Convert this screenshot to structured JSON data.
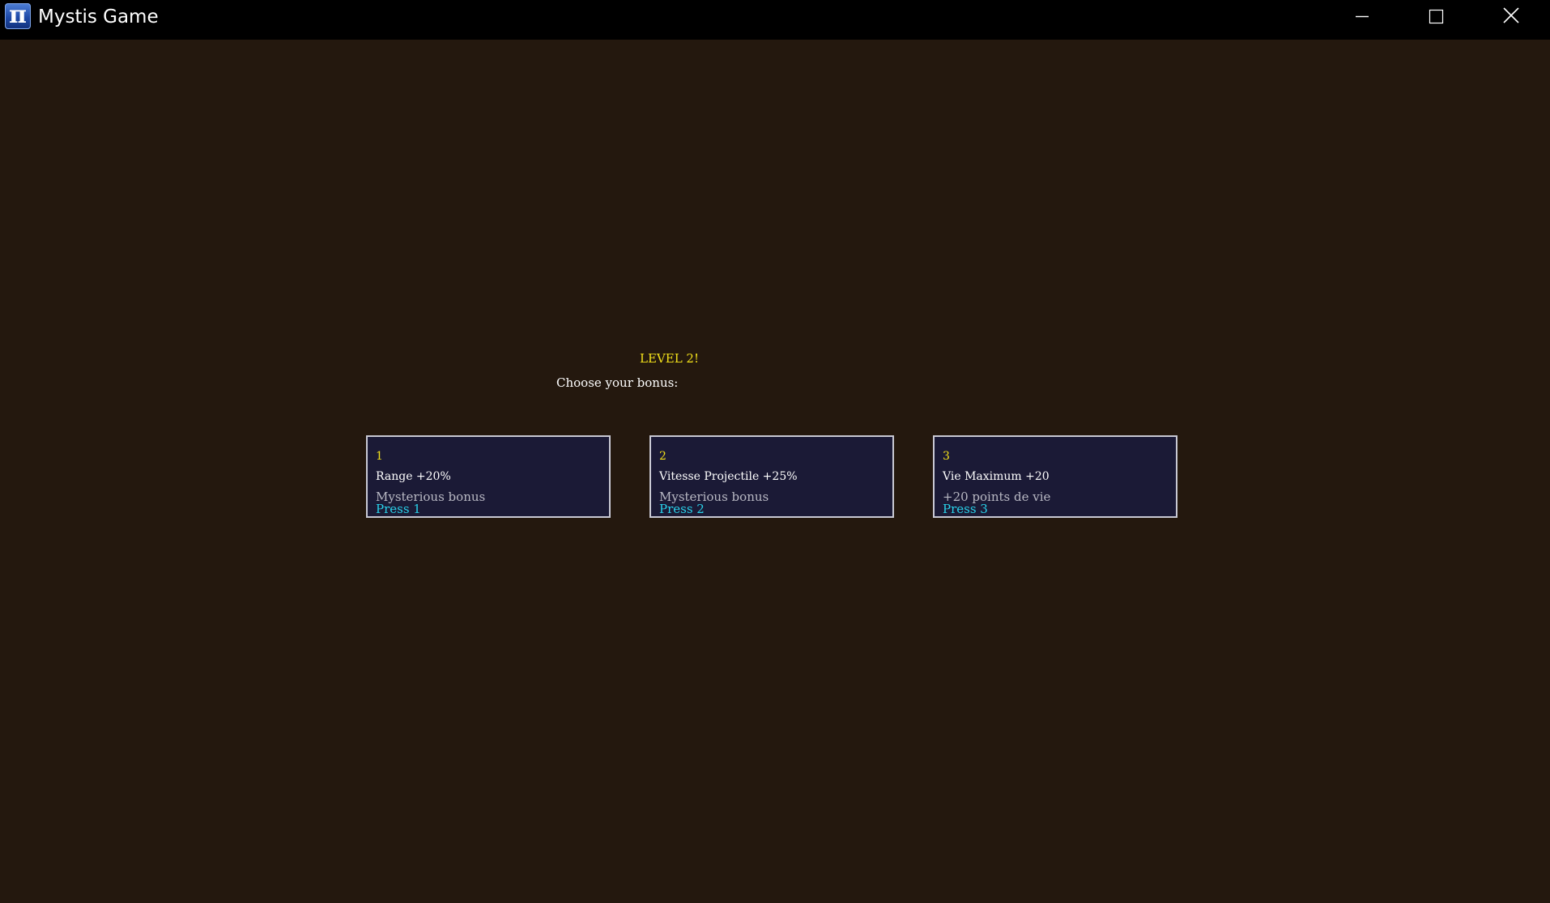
{
  "window": {
    "title": "Mystis Game",
    "app_icon_glyph": "π",
    "controls": {
      "minimize": "minimize-icon",
      "maximize": "maximize-icon",
      "close": "close-icon"
    }
  },
  "levelup": {
    "level_text": "LEVEL 2!",
    "prompt": "Choose your bonus:",
    "options": [
      {
        "number": "1",
        "name": "Range +20%",
        "description": "Mysterious bonus",
        "hint": "Press 1"
      },
      {
        "number": "2",
        "name": "Vitesse Projectile +25%",
        "description": "Mysterious bonus",
        "hint": "Press 2"
      },
      {
        "number": "3",
        "name": "Vie Maximum +20",
        "description": "+20 points de vie",
        "hint": "Press 3"
      }
    ]
  },
  "colors": {
    "background": "#24180e",
    "titlebar": "#000000",
    "card_fill": "#1b1a36",
    "card_border": "#c9c9d4",
    "level_text": "#f2e01a",
    "hint_text": "#29d2ea"
  }
}
